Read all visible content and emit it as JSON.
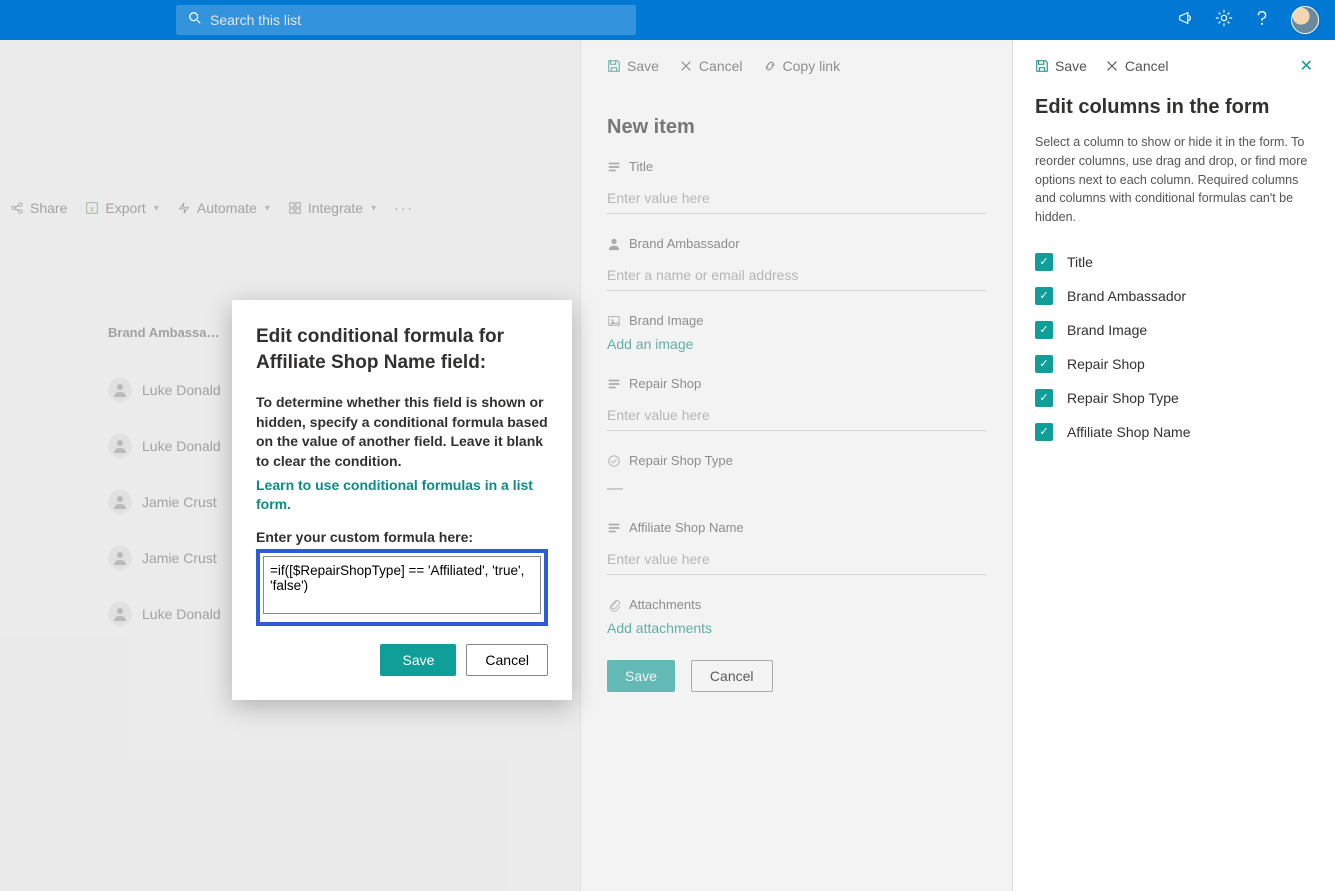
{
  "topbar": {
    "search_placeholder": "Search this list"
  },
  "bg_toolbar": {
    "share": "Share",
    "export": "Export",
    "automate": "Automate",
    "integrate": "Integrate"
  },
  "list": {
    "col_header": "Brand Ambassa…",
    "rows": [
      "Luke Donald",
      "Luke Donald",
      "Jamie Crust",
      "Jamie Crust",
      "Luke Donald"
    ]
  },
  "new_item": {
    "toolbar": {
      "save": "Save",
      "cancel": "Cancel",
      "copylink": "Copy link"
    },
    "heading": "New item",
    "fields": {
      "title": {
        "label": "Title",
        "placeholder": "Enter value here"
      },
      "brand_ambassador": {
        "label": "Brand Ambassador",
        "placeholder": "Enter a name or email address"
      },
      "brand_image": {
        "label": "Brand Image",
        "link": "Add an image"
      },
      "repair_shop": {
        "label": "Repair Shop",
        "placeholder": "Enter value here"
      },
      "repair_shop_type": {
        "label": "Repair Shop Type",
        "dash": "—"
      },
      "affiliate_shop_name": {
        "label": "Affiliate Shop Name",
        "placeholder": "Enter value here"
      },
      "attachments": {
        "label": "Attachments",
        "link": "Add attachments"
      }
    },
    "save_btn": "Save",
    "cancel_btn": "Cancel"
  },
  "cols_panel": {
    "save": "Save",
    "cancel": "Cancel",
    "heading": "Edit columns in the form",
    "desc": "Select a column to show or hide it in the form. To reorder columns, use drag and drop, or find more options next to each column. Required columns and columns with conditional formulas can't be hidden.",
    "items": [
      "Title",
      "Brand Ambassador",
      "Brand Image",
      "Repair Shop",
      "Repair Shop Type",
      "Affiliate Shop Name"
    ]
  },
  "modal": {
    "title": "Edit conditional formula for Affiliate Shop Name field:",
    "desc": "To determine whether this field is shown or hidden, specify a conditional formula based on the value of another field. Leave it blank to clear the condition.",
    "learn": "Learn to use conditional formulas in a list form.",
    "enter_label": "Enter your custom formula here:",
    "formula": "=if([$RepairShopType] == 'Affiliated', 'true', 'false')",
    "save": "Save",
    "cancel": "Cancel"
  }
}
